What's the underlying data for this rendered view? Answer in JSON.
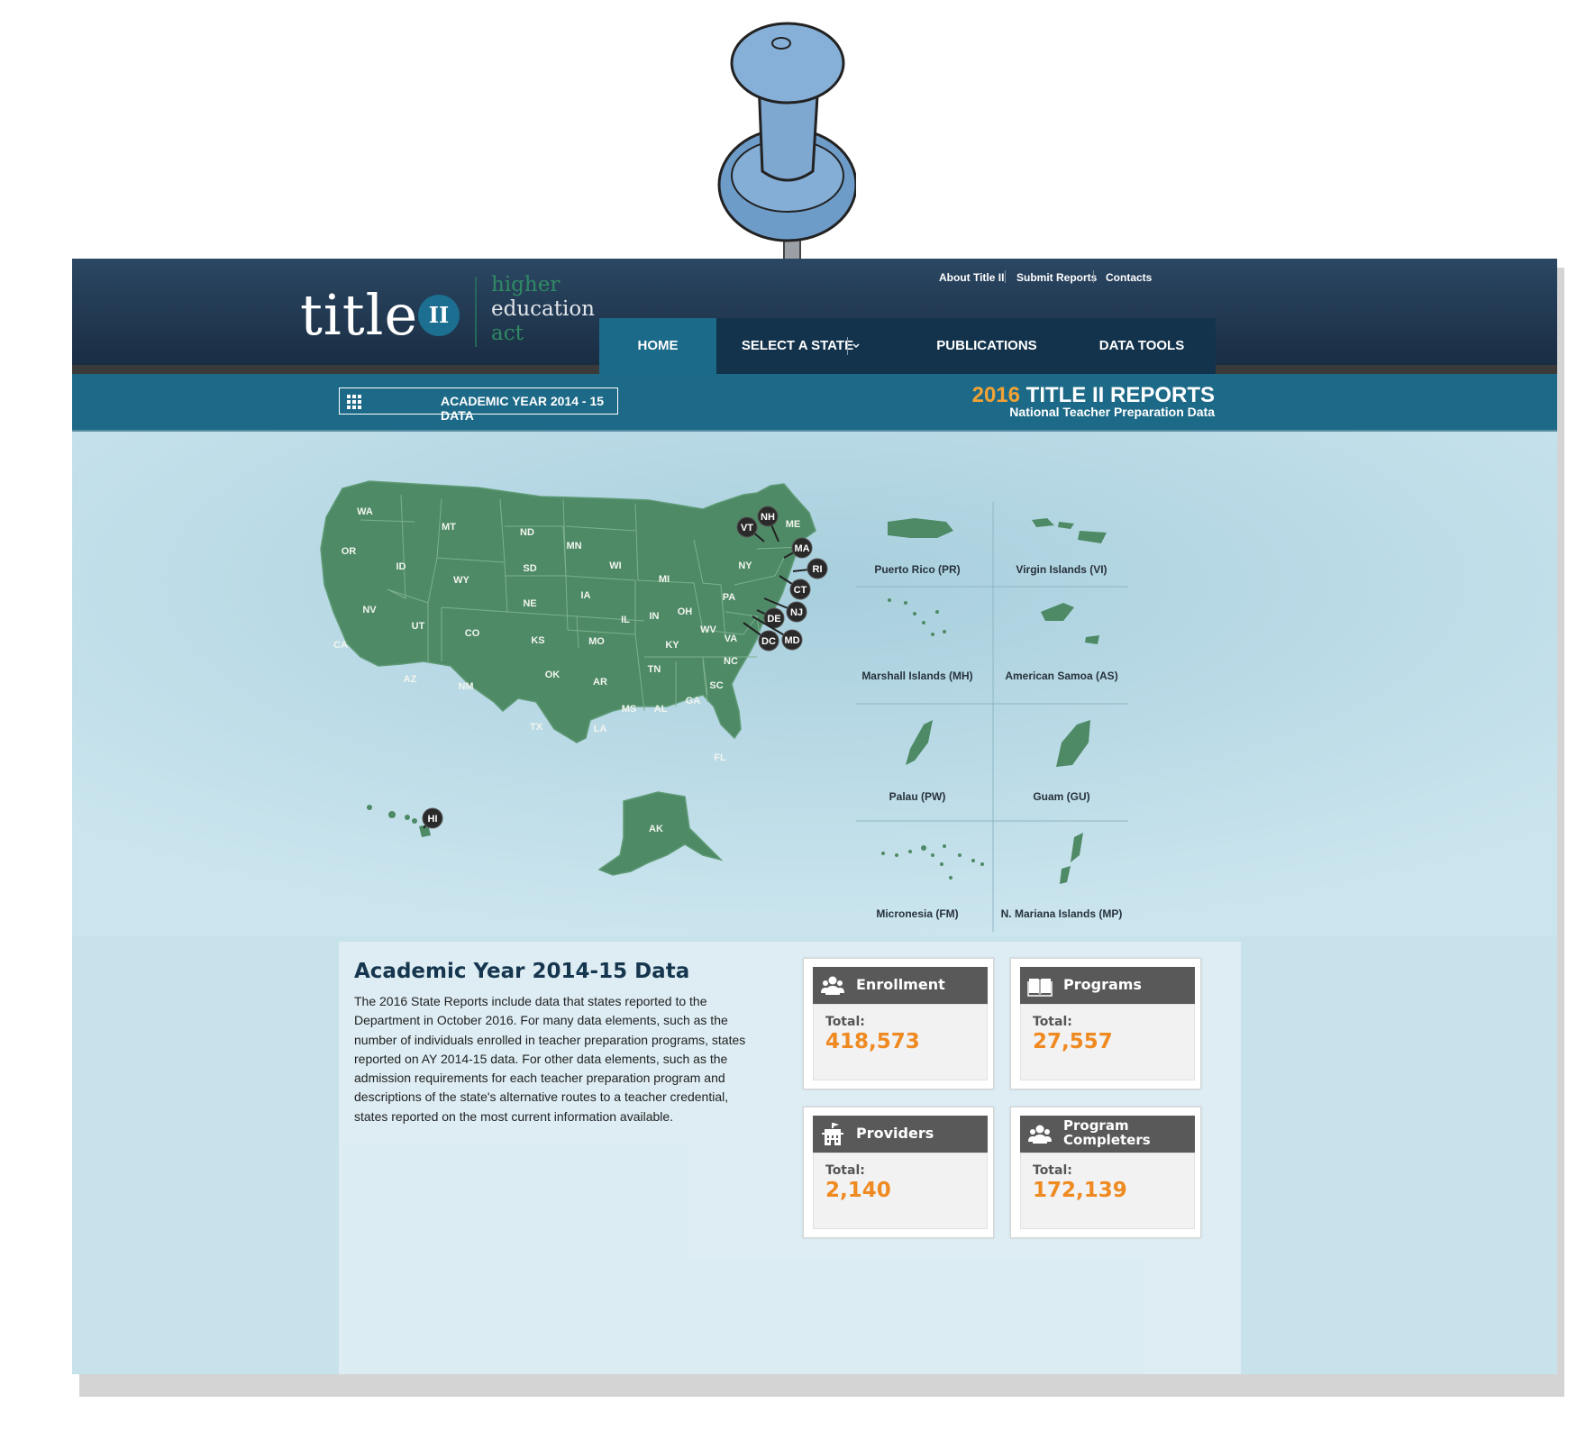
{
  "header": {
    "logo": {
      "title": "title",
      "badge": "II",
      "line1": "higher",
      "line2": "education",
      "line3": "act"
    },
    "utility_links": [
      "About Title II",
      "Submit Reports",
      "Contacts"
    ],
    "nav": [
      {
        "label": "HOME",
        "active": true
      },
      {
        "label": "SELECT A STATE",
        "has_dropdown": true
      },
      {
        "label": "PUBLICATIONS"
      },
      {
        "label": "DATA TOOLS"
      }
    ]
  },
  "subbar": {
    "year_button": {
      "icon": "grid-icon",
      "label": "ACADEMIC YEAR 2014 - 15 DATA"
    },
    "reports_year": "2016",
    "reports_title": " TITLE II REPORTS",
    "reports_subtitle": "National Teacher Preparation Data"
  },
  "map": {
    "states": [
      "WA",
      "OR",
      "CA",
      "ID",
      "NV",
      "MT",
      "WY",
      "UT",
      "AZ",
      "CO",
      "NM",
      "ND",
      "SD",
      "NE",
      "KS",
      "OK",
      "TX",
      "MN",
      "IA",
      "MO",
      "AR",
      "LA",
      "WI",
      "IL",
      "MI",
      "IN",
      "OH",
      "KY",
      "TN",
      "MS",
      "AL",
      "GA",
      "FL",
      "SC",
      "NC",
      "VA",
      "WV",
      "PA",
      "NY",
      "ME",
      "AK"
    ],
    "badges": [
      "VT",
      "NH",
      "MA",
      "RI",
      "CT",
      "NJ",
      "DE",
      "DC",
      "MD",
      "HI"
    ],
    "territories": [
      "Puerto Rico (PR)",
      "Virgin Islands (VI)",
      "Marshall Islands (MH)",
      "American Samoa (AS)",
      "Palau (PW)",
      "Guam (GU)",
      "Micronesia (FM)",
      "N. Mariana Islands (MP)"
    ],
    "fill_color": "#4e8a66"
  },
  "info": {
    "title": "Academic Year 2014-15 Data",
    "body": "The 2016 State Reports include data that states reported to the Department in October 2016. For many data elements, such as the number of individuals enrolled in teacher preparation programs, states reported on AY 2014-15 data. For other data elements, such as the admission requirements for each teacher preparation program and descriptions of the state's alternative routes to a teacher credential, states reported on the most current information available."
  },
  "stats": [
    {
      "title": "Enrollment",
      "icon": "people-icon",
      "label": "Total:",
      "value": "418,573"
    },
    {
      "title": "Programs",
      "icon": "book-icon",
      "label": "Total:",
      "value": "27,557"
    },
    {
      "title": "Providers",
      "icon": "building-icon",
      "label": "Total:",
      "value": "2,140"
    },
    {
      "title": "Program Completers",
      "icon": "people-icon",
      "label": "Total:",
      "value": "172,139"
    }
  ],
  "colors": {
    "accent_orange": "#ef8a21",
    "brand_blue": "#1d6a88",
    "header_navy": "#13334c"
  }
}
